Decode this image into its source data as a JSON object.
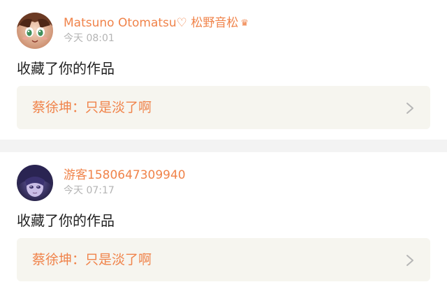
{
  "notifications": [
    {
      "username": "Matsuno Otomatsu♡ 松野音松",
      "badge_icon": "crown-icon",
      "timestamp": "今天 08:01",
      "action": "收藏了你的作品",
      "work": {
        "title": "蔡徐坤：只是淡了啊"
      }
    },
    {
      "username": "游客1580647309940",
      "timestamp": "今天 07:17",
      "action": "收藏了你的作品",
      "work": {
        "title": "蔡徐坤：只是淡了啊"
      }
    }
  ],
  "colors": {
    "accent": "#f0834a",
    "timestamp": "#b4b4b4",
    "card_ref_bg": "#f6f5ef",
    "divider": "#f3f3f3"
  }
}
